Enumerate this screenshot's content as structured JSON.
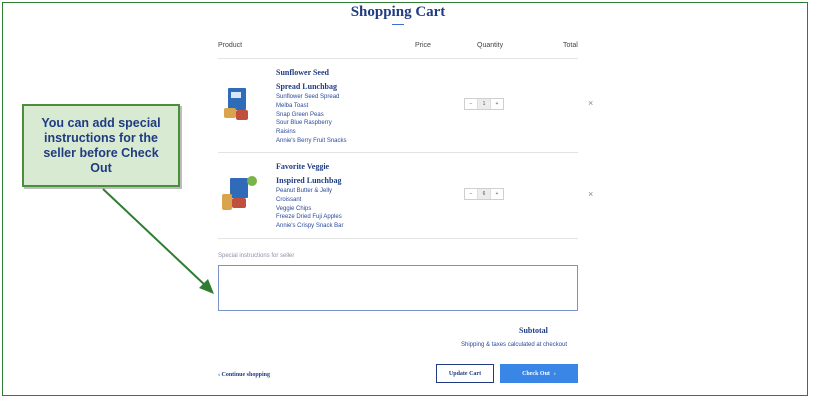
{
  "page": {
    "title": "Shopping Cart"
  },
  "table": {
    "headers": {
      "product": "Product",
      "price": "Price",
      "quantity": "Quantity",
      "total": "Total"
    }
  },
  "items": [
    {
      "title_lines": [
        "Sunflower Seed",
        "Spread Lunchbag"
      ],
      "contents": [
        "Sunflower Seed Spread",
        "Melba Toast",
        "Snap Green Peas",
        "Sour Blue Raspberry",
        "Raisins",
        "Annie's Berry Fruit Snacks"
      ],
      "quantity": "1",
      "remove": "×"
    },
    {
      "title_lines": [
        "Favorite Veggie",
        "Inspired Lunchbag"
      ],
      "contents": [
        "Peanut Butter & Jelly",
        "Croissant",
        "Veggie Chips",
        "Freeze Dried Fuji Apples",
        "Annie's Crispy Snack Bar"
      ],
      "quantity": "6",
      "remove": "×"
    }
  ],
  "qty_controls": {
    "minus": "−",
    "plus": "+"
  },
  "instructions": {
    "label": "Special instructions for seller",
    "value": ""
  },
  "summary": {
    "subtotal_label": "Subtotal",
    "shipping_note": "Shipping & taxes calculated at checkout"
  },
  "actions": {
    "continue": "‹ Continue shopping",
    "update": "Update Cart",
    "checkout": "Check Out",
    "checkout_arrow": "›"
  },
  "callout": {
    "lines": [
      "You can add special",
      "instructions for the",
      "seller before Check",
      "Out"
    ]
  },
  "colors": {
    "brand": "#1f3b82",
    "accent": "#3a86e6",
    "callout_bg": "#d9ead3",
    "callout_border": "#4a8f3a"
  }
}
